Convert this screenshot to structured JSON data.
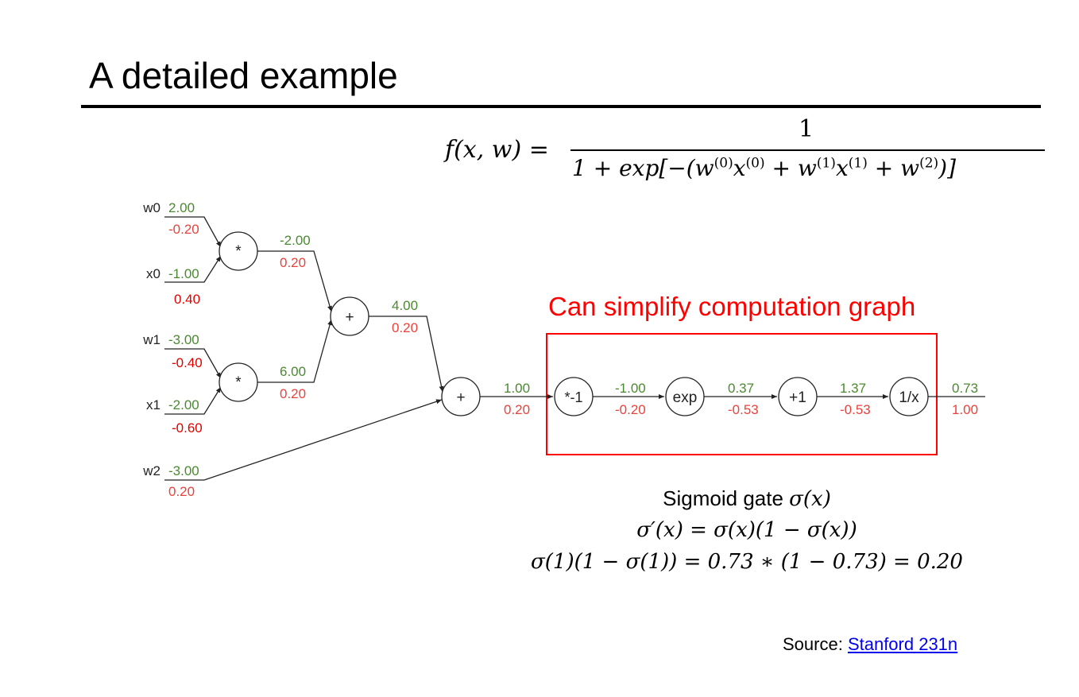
{
  "title": "A detailed example",
  "formula": {
    "lhs": "f(x, w) =",
    "numerator": "1",
    "denominator_pre": "1 + exp[−(w",
    "sup0": "(0)",
    "x_part": "x",
    "sup0b": "(0)",
    "plus1": " + w",
    "sup1": "(1)",
    "x_part2": "x",
    "sup1b": "(1)",
    "plus2": " + w",
    "sup2": "(2)",
    "close": ")]"
  },
  "simplify_label": "Can simplify computation graph",
  "graph": {
    "inputs": [
      {
        "name": "w0",
        "value": "2.00",
        "grad": "-0.20"
      },
      {
        "name": "x0",
        "value": "-1.00",
        "grad": "0.40"
      },
      {
        "name": "w1",
        "value": "-3.00",
        "grad": "-0.40"
      },
      {
        "name": "x1",
        "value": "-2.00",
        "grad": "-0.60"
      },
      {
        "name": "w2",
        "value": "-3.00",
        "grad": "0.20"
      }
    ],
    "gates": [
      {
        "id": "mul0",
        "label": "*"
      },
      {
        "id": "mul1",
        "label": "*"
      },
      {
        "id": "add0",
        "label": "+"
      },
      {
        "id": "add1",
        "label": "+"
      },
      {
        "id": "neg",
        "label": "*-1"
      },
      {
        "id": "exp",
        "label": "exp"
      },
      {
        "id": "plus1",
        "label": "+1"
      },
      {
        "id": "recip",
        "label": "1/x"
      }
    ],
    "edges": [
      {
        "id": "mul0_out",
        "value": "-2.00",
        "grad": "0.20"
      },
      {
        "id": "mul1_out",
        "value": "6.00",
        "grad": "0.20"
      },
      {
        "id": "add0_out",
        "value": "4.00",
        "grad": "0.20"
      },
      {
        "id": "add1_out",
        "value": "1.00",
        "grad": "0.20"
      },
      {
        "id": "neg_out",
        "value": "-1.00",
        "grad": "-0.20"
      },
      {
        "id": "exp_out",
        "value": "0.37",
        "grad": "-0.53"
      },
      {
        "id": "plus1_out",
        "value": "1.37",
        "grad": "-0.53"
      },
      {
        "id": "recip_out",
        "value": "0.73",
        "grad": "1.00"
      }
    ]
  },
  "sigmoid": {
    "line1_text": "Sigmoid gate ",
    "line1_math": "σ(x)",
    "line2": "σ′(x) = σ(x)(1 − σ(x))",
    "line3": "σ(1)(1 − σ(1)) = 0.73 ∗ (1 − 0.73) = 0.20"
  },
  "source": {
    "label": "Source: ",
    "link_text": "Stanford 231n"
  },
  "colors": {
    "value": "#4a8a2e",
    "grad": "#e8423c",
    "grad_strong": "#e00000",
    "highlight": "#ff0000"
  }
}
